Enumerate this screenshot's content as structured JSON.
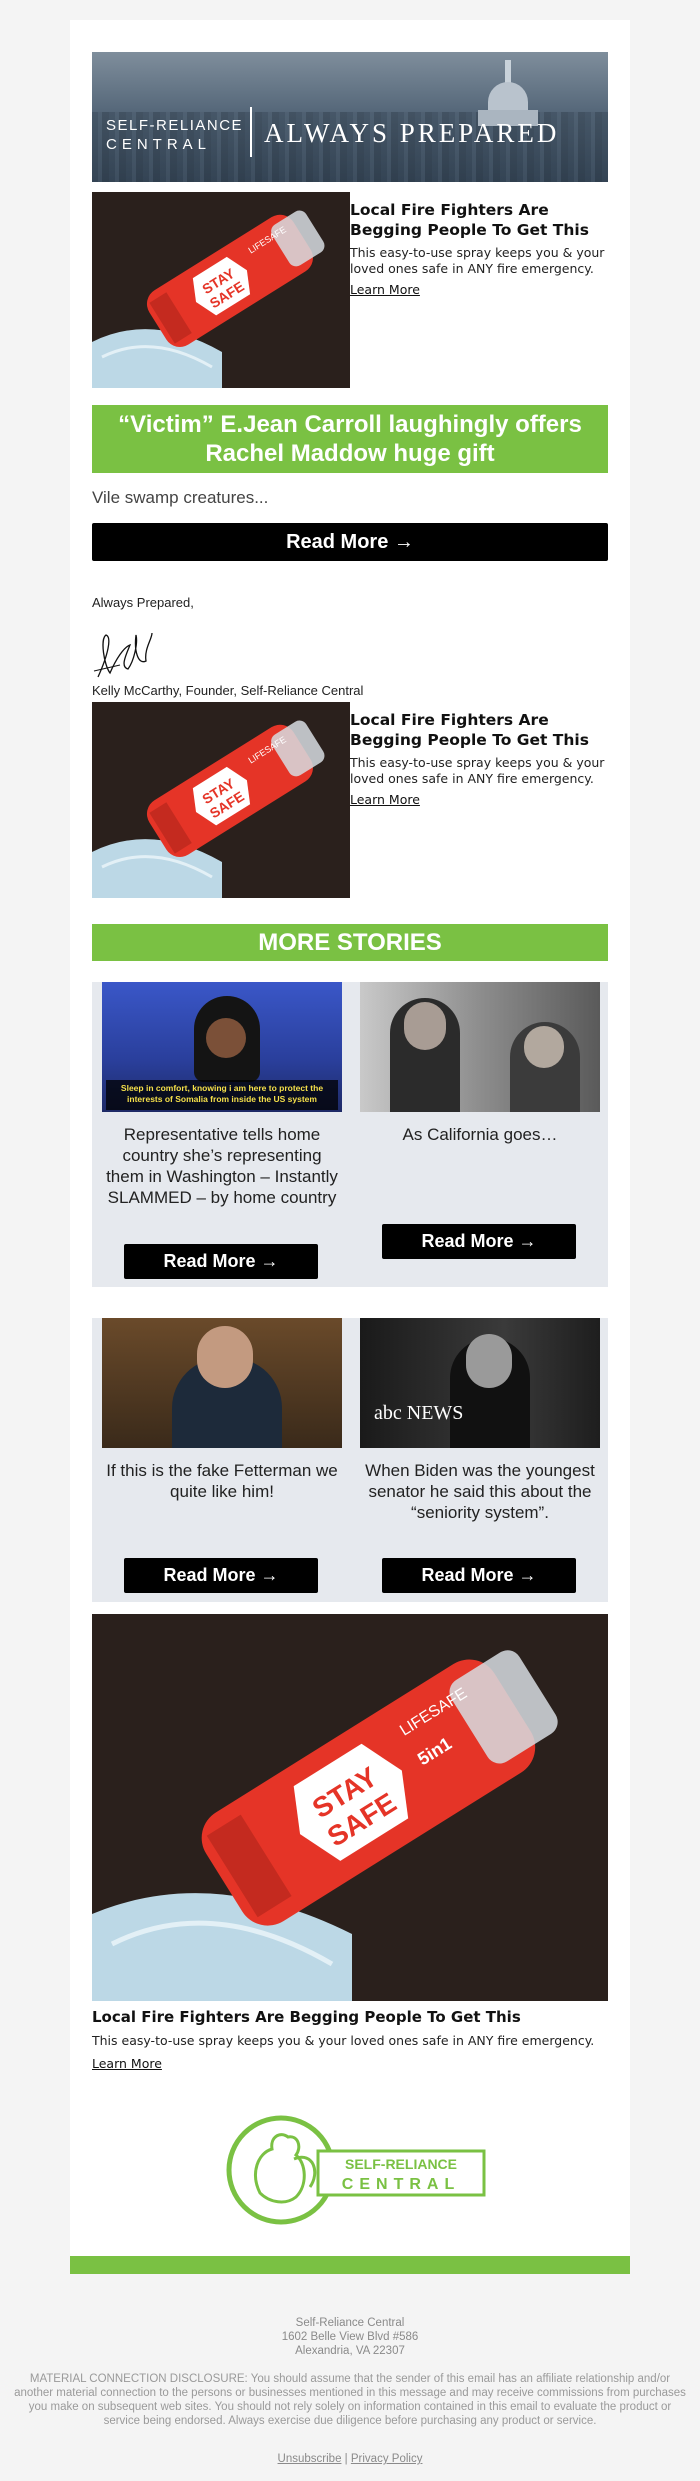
{
  "header": {
    "brand_line1": "SELF-RELIANCE",
    "brand_line2": "CENTRAL",
    "tagline": "ALWAYS PREPARED"
  },
  "ad": {
    "title": "Local Fire Fighters Are Begging People To Get This",
    "description": "This easy-to-use spray keeps you & your loved ones safe in ANY fire emergency.",
    "link_label": "Learn More",
    "product_label_1": "STAY",
    "product_label_2": "SAFE",
    "product_label_3": "5in1",
    "product_label_4": "LIFESAFE"
  },
  "main_story": {
    "headline": "“Victim” E.Jean Carroll laughingly offers Rachel Maddow huge gift",
    "teaser": "Vile swamp creatures...",
    "read_more_label": "Read More →"
  },
  "signoff": {
    "closing": "Always Prepared,",
    "name": "Kelly McCarthy, Founder, Self-Reliance Central"
  },
  "more_stories": {
    "section_title": "MORE STORIES",
    "rows": [
      {
        "items": [
          {
            "caption": "Representative tells home country she’s representing them in Washington – Instantly SLAMMED – by home country",
            "thumb_overlay": "Sleep in comfort, knowing i am here to protect the interests of Somalia from inside the US system",
            "read_more_label": "Read More →"
          },
          {
            "caption": "As California goes…",
            "read_more_label": "Read More →"
          }
        ]
      },
      {
        "items": [
          {
            "caption": "If this is the fake Fetterman we quite like him!",
            "read_more_label": "Read More →"
          },
          {
            "caption": "When Biden was the youngest senator he said this about the “seniority system”.",
            "thumb_overlay": "abc NEWS",
            "read_more_label": "Read More →"
          }
        ]
      }
    ]
  },
  "footer_logo": {
    "line1": "SELF-RELIANCE",
    "line2": "CENTRAL"
  },
  "footer": {
    "company": "Self-Reliance Central",
    "address_line1": "1602 Belle View Blvd #586",
    "address_line2": "Alexandria, VA 22307",
    "disclosure": "MATERIAL CONNECTION DISCLOSURE: You should assume that the sender of this email has an affiliate relationship and/or another material connection to the persons or businesses mentioned in this message and may receive commissions from purchases you make on subsequent web sites. You should not rely solely on information contained in this email to evaluate the product or service being endorsed. Always exercise due diligence before purchasing any product or service.",
    "unsubscribe_label": "Unsubscribe",
    "separator": "|",
    "privacy_label": "Privacy Policy"
  },
  "colors": {
    "accent_green": "#7ac143",
    "button_black": "#000000",
    "story_bg": "#e6e9ee"
  }
}
